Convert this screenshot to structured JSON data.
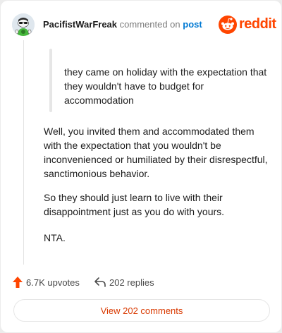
{
  "comment": {
    "username": "PacifistWarFreak",
    "action_text": "commented on",
    "post_link": "post",
    "quote": "they came on holiday with the expectation that they wouldn't have to budget for accommodation",
    "paragraphs": [
      "Well, you invited them and accommodated them with the expectation that you wouldn't be inconvenienced or humiliated by their disrespectful, sanctimonious behavior.",
      "So they should just learn to live with their disappointment just as you do with yours.",
      "NTA."
    ]
  },
  "brand": {
    "logo_text": "reddit",
    "color": "#ff4500"
  },
  "actions": {
    "upvotes": "6.7K upvotes",
    "replies": "202 replies"
  },
  "view_button": {
    "label": "View 202 comments"
  },
  "icons": {
    "upvote": "upvote-arrow-icon",
    "reply": "reply-arrow-icon",
    "logo": "reddit-alien-icon",
    "avatar": "snoo-avatar"
  }
}
